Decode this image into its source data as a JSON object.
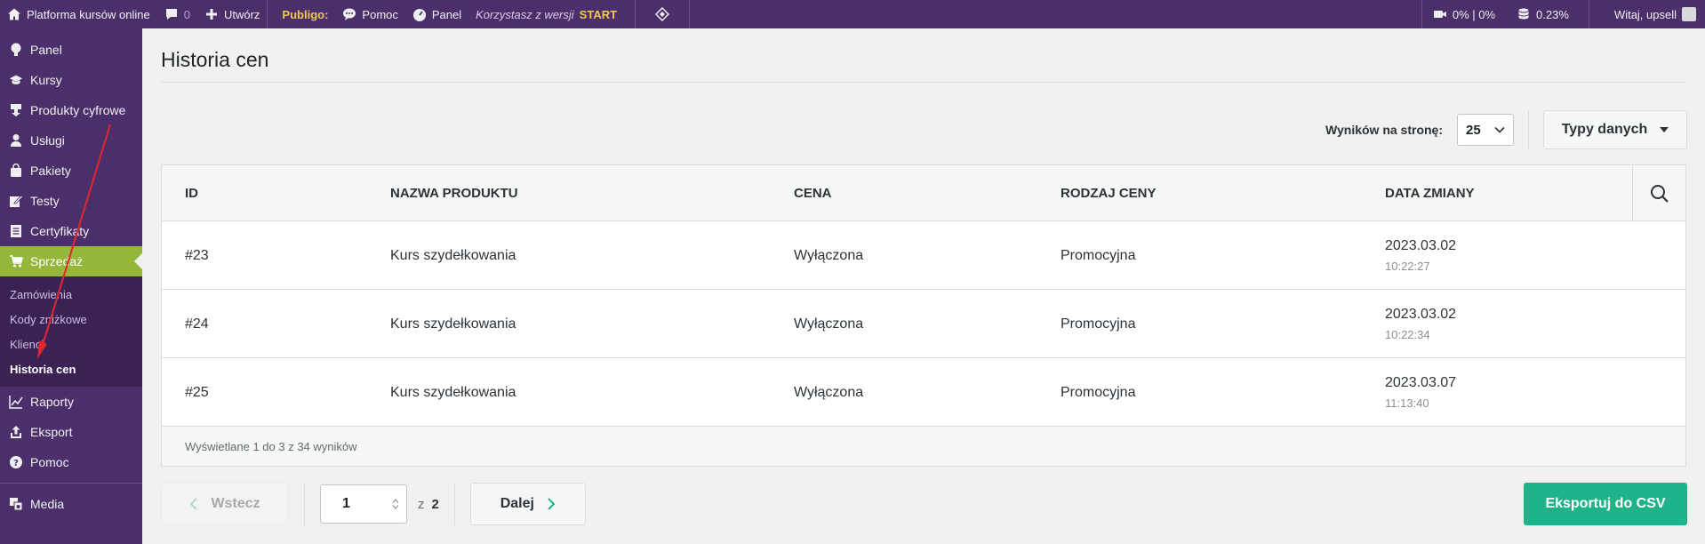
{
  "adminbar": {
    "site_name": "Platforma kursów online",
    "comments_count": "0",
    "create_label": "Utwórz",
    "brand": "Publigo:",
    "help_label": "Pomoc",
    "panel_label": "Panel",
    "version_text": "Korzystasz z wersji",
    "version_name": "START",
    "video_stats": "0% | 0%",
    "storage_stats": "0.23%",
    "greeting": "Witaj, upsell"
  },
  "sidebar": {
    "items": [
      {
        "label": "Panel",
        "icon": "gauge-icon"
      },
      {
        "label": "Kursy",
        "icon": "graduation-cap-icon"
      },
      {
        "label": "Produkty cyfrowe",
        "icon": "download-icon"
      },
      {
        "label": "Usługi",
        "icon": "user-icon"
      },
      {
        "label": "Pakiety",
        "icon": "bag-icon"
      },
      {
        "label": "Testy",
        "icon": "edit-icon"
      },
      {
        "label": "Certyfikaty",
        "icon": "document-icon"
      },
      {
        "label": "Sprzedaż",
        "icon": "cart-icon"
      }
    ],
    "submenu": [
      {
        "label": "Zamówienia"
      },
      {
        "label": "Kody zniżkowe"
      },
      {
        "label": "Klienci"
      },
      {
        "label": "Historia cen"
      }
    ],
    "items_after": [
      {
        "label": "Raporty",
        "icon": "chart-icon"
      },
      {
        "label": "Eksport",
        "icon": "export-icon"
      },
      {
        "label": "Pomoc",
        "icon": "help-icon"
      }
    ],
    "media_label": "Media"
  },
  "main": {
    "title": "Historia cen",
    "per_page_label": "Wyników na stronę:",
    "per_page_value": "25",
    "data_types_label": "Typy danych",
    "table": {
      "headers": [
        "ID",
        "NAZWA PRODUKTU",
        "CENA",
        "RODZAJ CENY",
        "DATA ZMIANY"
      ],
      "rows": [
        {
          "id": "#23",
          "name": "Kurs szydełkowania",
          "price": "Wyłączona",
          "type": "Promocyjna",
          "date": "2023.03.02",
          "time": "10:22:27"
        },
        {
          "id": "#24",
          "name": "Kurs szydełkowania",
          "price": "Wyłączona",
          "type": "Promocyjna",
          "date": "2023.03.02",
          "time": "10:22:34"
        },
        {
          "id": "#25",
          "name": "Kurs szydełkowania",
          "price": "Wyłączona",
          "type": "Promocyjna",
          "date": "2023.03.07",
          "time": "11:13:40"
        }
      ],
      "footer": "Wyświetlane 1 do 3 z 34 wyników"
    },
    "pagination": {
      "prev_label": "Wstecz",
      "current_page": "1",
      "of_label": "z",
      "total_pages": "2",
      "next_label": "Dalej"
    },
    "export_label": "Eksportuj do CSV"
  },
  "colors": {
    "adminbar_bg": "#4b2f6b",
    "active_menu": "#94b63a",
    "export_button": "#1fb38a",
    "annotation_arrow": "#e3262d"
  }
}
